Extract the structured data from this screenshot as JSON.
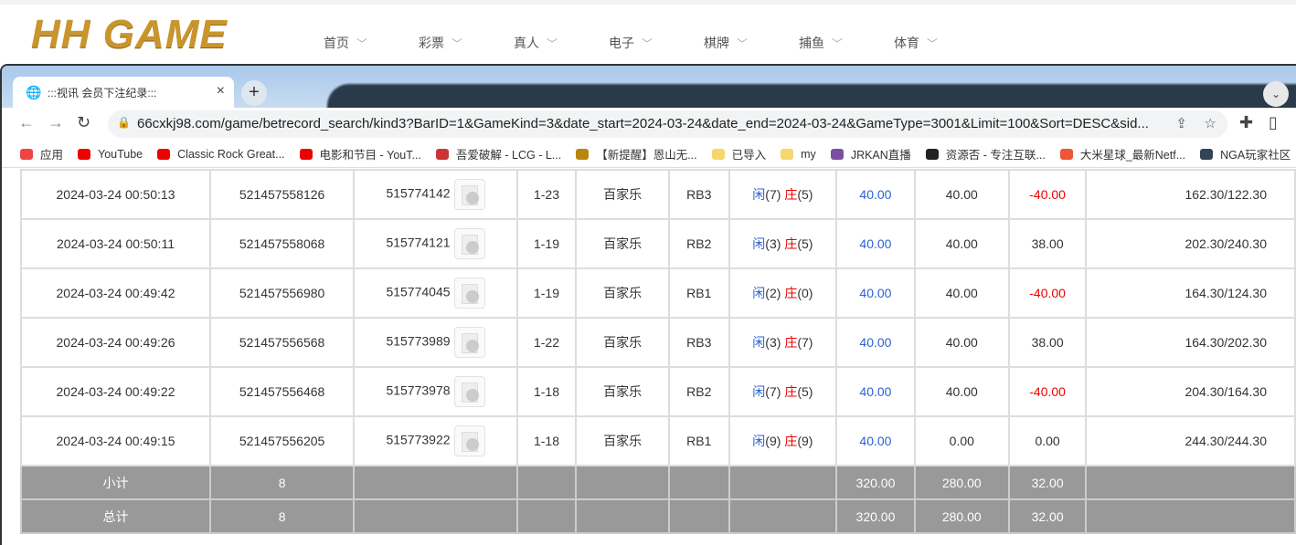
{
  "site": {
    "logo": "HH GAME",
    "nav": [
      "首页",
      "彩票",
      "真人",
      "电子",
      "棋牌",
      "捕鱼",
      "体育"
    ]
  },
  "browser": {
    "tab_title": ":::视讯 会员下注纪录:::",
    "url": "66cxkj98.com/game/betrecord_search/kind3?BarID=1&GameKind=3&date_start=2024-03-24&date_end=2024-03-24&GameType=3001&Limit=100&Sort=DESC&sid...",
    "bookmarks": [
      {
        "label": "应用",
        "color": "#e44"
      },
      {
        "label": "YouTube",
        "color": "#e00"
      },
      {
        "label": "Classic Rock Great...",
        "color": "#e00"
      },
      {
        "label": "电影和节目 - YouT...",
        "color": "#e00"
      },
      {
        "label": "吾爱破解 - LCG - L...",
        "color": "#c33"
      },
      {
        "label": "【新提醒】恩山无...",
        "color": "#b8860b"
      },
      {
        "label": "已导入",
        "color": "#f5d76e"
      },
      {
        "label": "my",
        "color": "#f5d76e"
      },
      {
        "label": "JRKAN直播",
        "color": "#7b4fa0"
      },
      {
        "label": "资源否 - 专注互联...",
        "color": "#222"
      },
      {
        "label": "大米星球_最新Netf...",
        "color": "#e53"
      },
      {
        "label": "NGA玩家社区",
        "color": "#345"
      }
    ]
  },
  "rows": [
    {
      "time": "2024-03-24 00:50:13",
      "bet_id": "521457558126",
      "round": "515774142",
      "shoe": "1-23",
      "game": "百家乐",
      "table": "RB3",
      "player": "闲",
      "pv": "(7)",
      "banker": "庄",
      "bv": "(5)",
      "bet": "40.00",
      "valid": "40.00",
      "win": "-40.00",
      "neg": true,
      "balance": "162.30/122.30"
    },
    {
      "time": "2024-03-24 00:50:11",
      "bet_id": "521457558068",
      "round": "515774121",
      "shoe": "1-19",
      "game": "百家乐",
      "table": "RB2",
      "player": "闲",
      "pv": "(3)",
      "banker": "庄",
      "bv": "(5)",
      "bet": "40.00",
      "valid": "40.00",
      "win": "38.00",
      "neg": false,
      "balance": "202.30/240.30"
    },
    {
      "time": "2024-03-24 00:49:42",
      "bet_id": "521457556980",
      "round": "515774045",
      "shoe": "1-19",
      "game": "百家乐",
      "table": "RB1",
      "player": "闲",
      "pv": "(2)",
      "banker": "庄",
      "bv": "(0)",
      "bet": "40.00",
      "valid": "40.00",
      "win": "-40.00",
      "neg": true,
      "balance": "164.30/124.30"
    },
    {
      "time": "2024-03-24 00:49:26",
      "bet_id": "521457556568",
      "round": "515773989",
      "shoe": "1-22",
      "game": "百家乐",
      "table": "RB3",
      "player": "闲",
      "pv": "(3)",
      "banker": "庄",
      "bv": "(7)",
      "bet": "40.00",
      "valid": "40.00",
      "win": "38.00",
      "neg": false,
      "balance": "164.30/202.30"
    },
    {
      "time": "2024-03-24 00:49:22",
      "bet_id": "521457556468",
      "round": "515773978",
      "shoe": "1-18",
      "game": "百家乐",
      "table": "RB2",
      "player": "闲",
      "pv": "(7)",
      "banker": "庄",
      "bv": "(5)",
      "bet": "40.00",
      "valid": "40.00",
      "win": "-40.00",
      "neg": true,
      "balance": "204.30/164.30"
    },
    {
      "time": "2024-03-24 00:49:15",
      "bet_id": "521457556205",
      "round": "515773922",
      "shoe": "1-18",
      "game": "百家乐",
      "table": "RB1",
      "player": "闲",
      "pv": "(9)",
      "banker": "庄",
      "bv": "(9)",
      "bet": "40.00",
      "valid": "0.00",
      "win": "0.00",
      "neg": false,
      "balance": "244.30/244.30"
    }
  ],
  "subtotal": {
    "label": "小计",
    "count": "8",
    "bet": "320.00",
    "valid": "280.00",
    "win": "32.00"
  },
  "total": {
    "label": "总计",
    "count": "8",
    "bet": "320.00",
    "valid": "280.00",
    "win": "32.00"
  }
}
